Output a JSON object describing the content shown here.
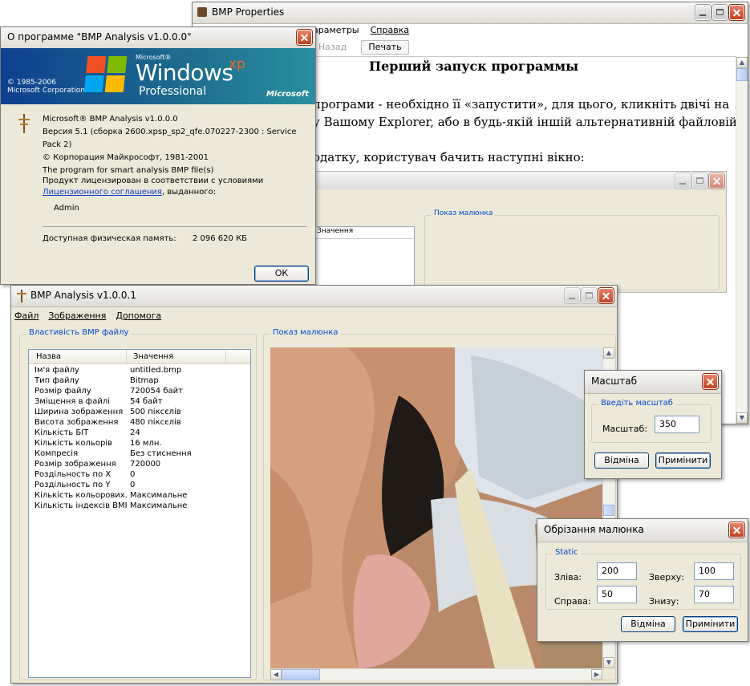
{
  "bmp_properties": {
    "title": "BMP Properties",
    "menu": [
      "араметры",
      "Справка"
    ],
    "toolbar": {
      "back": "Назад",
      "print": "Печать"
    },
    "doc": {
      "heading": "Перший запуск программы",
      "line1": "програми - необхідно її «запустити», для цього, кликніть двічі на",
      "line2": "у Вашому Explorer, або в будь-якій іншій альтернативній файловій",
      "line3": "одатку, користувач бачить наступні вікно:"
    },
    "inner": {
      "column": "Значення",
      "group": "Показ малюнка"
    }
  },
  "about": {
    "title": "О программе \"BMP Analysis v1.0.0.0\"",
    "banner": {
      "copyright1": "© 1985-2006",
      "copyright2": "Microsoft Corporation",
      "microsoft_small": "Microsoft®",
      "windows": "Windows",
      "xp": "xp",
      "professional": "Professional",
      "microsoft": "Microsoft"
    },
    "lines": [
      "Microsoft® BMP Analysis v1.0.0.0",
      "Версия 5.1 (сборка 2600.xpsp_sp2_qfe.070227-2300 : Service Pack 2)",
      "© Корпорация Майкрософт, 1981-2001",
      "The program for smart analysis BMP file(s)"
    ],
    "license_text": "Продукт лицензирован в соответствии с условиями",
    "license_link": "Лицензионного соглашения",
    "license_tail": ", выданного:",
    "user": "Admin",
    "memory_label": "Доступная физическая память:",
    "memory_value": "2 096 620 КБ",
    "ok": "ОК"
  },
  "main": {
    "title": "BMP Analysis v1.0.0.1",
    "menu": [
      "Файл",
      "Зображення",
      "Допомога"
    ],
    "props_group": "Властивість BMP файлу",
    "image_group": "Показ малюнка",
    "columns": [
      "Назва",
      "Значення"
    ],
    "rows": [
      [
        "Ім'я файлу",
        "untitled.bmp"
      ],
      [
        "Тип файлу",
        "Bitmap"
      ],
      [
        "Розмір файлу",
        "720054 байт"
      ],
      [
        "Зміщення в файлі",
        "54 байт"
      ],
      [
        "Ширина зображення",
        "500 піксєлів"
      ],
      [
        "Висота зображення",
        "480 піксєлів"
      ],
      [
        "Кількість БІТ",
        "24"
      ],
      [
        "Кількість кольорів",
        "16 млн."
      ],
      [
        "Компресія",
        "Без стиснення"
      ],
      [
        "Розмір зображення",
        "720000"
      ],
      [
        "Роздільность по X",
        "0"
      ],
      [
        "Роздільность по Y",
        "0"
      ],
      [
        "Кількість кольорових...",
        "Максимальне"
      ],
      [
        "Кількість індексів BMP",
        "Максимальне"
      ]
    ]
  },
  "scale": {
    "title": "Масштаб",
    "group": "Введіть масштаб",
    "label": "Масштаб:",
    "value": "350",
    "cancel": "Відміна",
    "apply": "Примінити"
  },
  "crop": {
    "title": "Обрізання малюнка",
    "group": "Static",
    "left_label": "Зліва:",
    "left_value": "200",
    "top_label": "Зверху:",
    "top_value": "100",
    "right_label": "Справа:",
    "right_value": "50",
    "bottom_label": "Знизу:",
    "bottom_value": "70",
    "cancel": "Відміна",
    "apply": "Примінити"
  }
}
